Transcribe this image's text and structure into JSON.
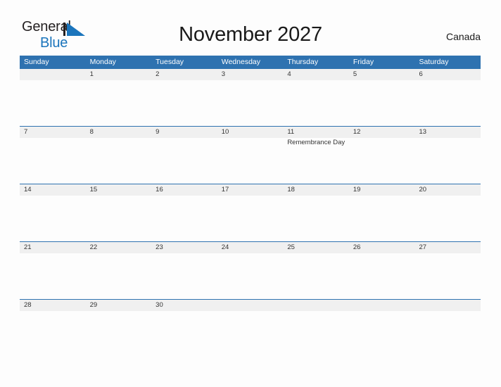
{
  "brand": {
    "line1": "General",
    "line2": "Blue",
    "mark": "triangle-logo",
    "colors": {
      "text_dark": "#231f20",
      "text_blue": "#1b75bc",
      "mark_blue": "#1b75bc"
    }
  },
  "header": {
    "title": "November 2027",
    "region": "Canada"
  },
  "theme": {
    "header_blue": "#2e72b0",
    "date_band_gray": "#f0f0f0",
    "page_background": "#fdfdfd",
    "date_text": "#333333"
  },
  "calendar": {
    "weekday_names": [
      "Sunday",
      "Monday",
      "Tuesday",
      "Wednesday",
      "Thursday",
      "Friday",
      "Saturday"
    ],
    "weeks": [
      {
        "days": [
          {
            "date": "",
            "events": []
          },
          {
            "date": "1",
            "events": []
          },
          {
            "date": "2",
            "events": []
          },
          {
            "date": "3",
            "events": []
          },
          {
            "date": "4",
            "events": []
          },
          {
            "date": "5",
            "events": []
          },
          {
            "date": "6",
            "events": []
          }
        ]
      },
      {
        "days": [
          {
            "date": "7",
            "events": []
          },
          {
            "date": "8",
            "events": []
          },
          {
            "date": "9",
            "events": []
          },
          {
            "date": "10",
            "events": []
          },
          {
            "date": "11",
            "events": [
              "Remembrance Day"
            ]
          },
          {
            "date": "12",
            "events": []
          },
          {
            "date": "13",
            "events": []
          }
        ]
      },
      {
        "days": [
          {
            "date": "14",
            "events": []
          },
          {
            "date": "15",
            "events": []
          },
          {
            "date": "16",
            "events": []
          },
          {
            "date": "17",
            "events": []
          },
          {
            "date": "18",
            "events": []
          },
          {
            "date": "19",
            "events": []
          },
          {
            "date": "20",
            "events": []
          }
        ]
      },
      {
        "days": [
          {
            "date": "21",
            "events": []
          },
          {
            "date": "22",
            "events": []
          },
          {
            "date": "23",
            "events": []
          },
          {
            "date": "24",
            "events": []
          },
          {
            "date": "25",
            "events": []
          },
          {
            "date": "26",
            "events": []
          },
          {
            "date": "27",
            "events": []
          }
        ]
      },
      {
        "days": [
          {
            "date": "28",
            "events": []
          },
          {
            "date": "29",
            "events": []
          },
          {
            "date": "30",
            "events": []
          },
          {
            "date": "",
            "events": []
          },
          {
            "date": "",
            "events": []
          },
          {
            "date": "",
            "events": []
          },
          {
            "date": "",
            "events": []
          }
        ]
      }
    ]
  }
}
